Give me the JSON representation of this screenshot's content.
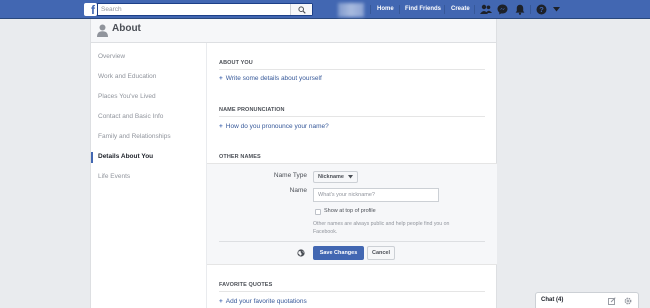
{
  "topbar": {
    "logo": "f",
    "search_placeholder": "Search",
    "nav": [
      "Home",
      "Find Friends",
      "Create"
    ],
    "icons": [
      "friends-icon",
      "messenger-icon",
      "notifications-icon",
      "help-icon",
      "dropdown-icon"
    ]
  },
  "header": {
    "title": "About"
  },
  "sidebar": {
    "items": [
      {
        "label": "Overview"
      },
      {
        "label": "Work and Education"
      },
      {
        "label": "Places You've Lived"
      },
      {
        "label": "Contact and Basic Info"
      },
      {
        "label": "Family and Relationships"
      },
      {
        "label": "Details About You",
        "active": true
      },
      {
        "label": "Life Events"
      }
    ]
  },
  "about_you": {
    "title": "ABOUT YOU",
    "link": "Write some details about yourself"
  },
  "pronunciation": {
    "title": "NAME PRONUNCIATION",
    "link": "How do you pronounce your name?"
  },
  "other_names": {
    "title": "OTHER NAMES",
    "name_type_label": "Name Type",
    "name_type_value": "Nickname",
    "name_label": "Name",
    "name_placeholder": "What's your nickname?",
    "checkbox_label": "Show at top of profile",
    "help": "Other names are always public and help people find you on Facebook.",
    "save": "Save Changes",
    "cancel": "Cancel"
  },
  "quotes": {
    "title": "FAVORITE QUOTES",
    "link": "Add your favorite quotations"
  },
  "chat": {
    "label": "Chat (4)"
  },
  "colors": {
    "brand": "#4267b2",
    "link": "#365899",
    "background": "#e9ebee"
  }
}
